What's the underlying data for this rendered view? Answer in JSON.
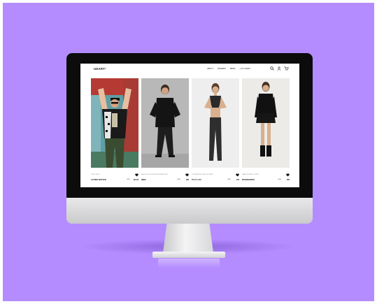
{
  "site": {
    "logo": "UDART°",
    "nav": [
      "ABOUT",
      "WOMENS",
      "MENS",
      "+ MY UDART"
    ],
    "icons": [
      "search-icon",
      "user-icon",
      "cart-icon"
    ]
  },
  "products": [
    {
      "tag": "THE STEVE",
      "name": "ALFRED WATSON",
      "currency": "AUD",
      "price": "120.00"
    },
    {
      "tag": "BLACK BOXY BOWLER BLAZER SET",
      "name": "INDIE",
      "currency": "AUD",
      "price": "280"
    },
    {
      "tag": "COMPRESSION ACTIVE PANT",
      "name": "TULLY LOU",
      "currency": "AUD",
      "price": "150"
    },
    {
      "tag": "DARK BLAZER & SKIRT",
      "name": "BOOKKEEPER",
      "currency": "AUD",
      "price": "385"
    }
  ],
  "colors": {
    "background": "#b48cff",
    "bezel": "#0c0c0c",
    "aluminium": "#d9d9dc"
  }
}
